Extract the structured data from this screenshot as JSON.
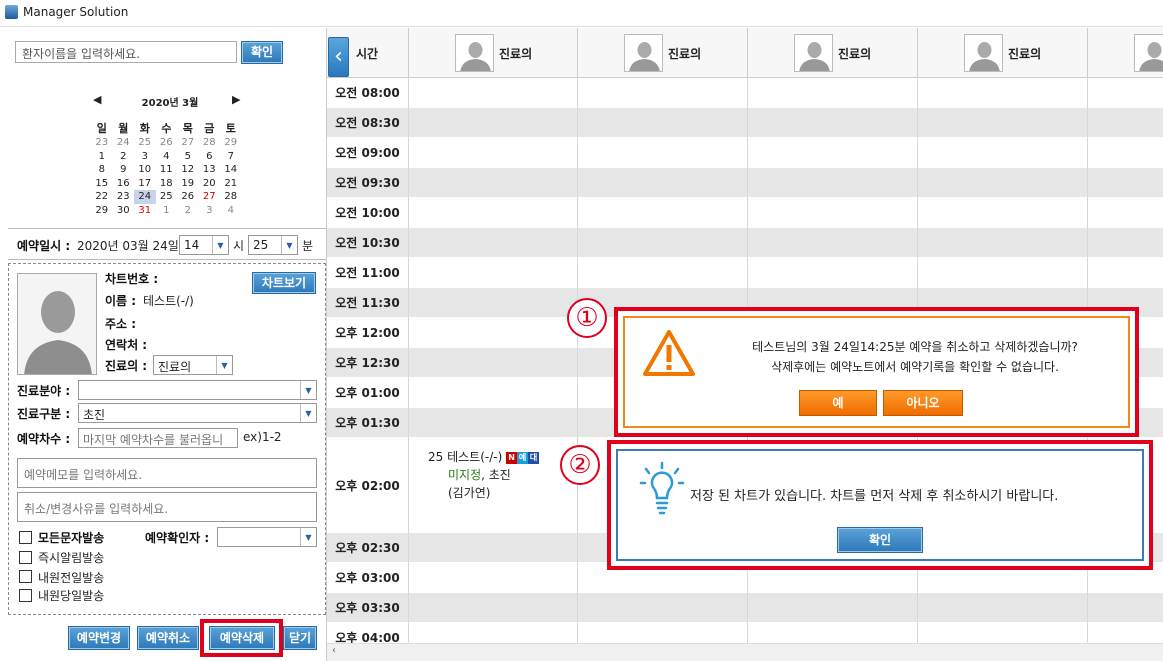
{
  "window": {
    "title": "Manager Solution"
  },
  "search": {
    "placeholder": "환자이름을 입력하세요.",
    "confirm_label": "확인"
  },
  "calendar": {
    "month": "2020년 3월",
    "weekdays": [
      "일",
      "월",
      "화",
      "수",
      "목",
      "금",
      "토"
    ],
    "weeks": [
      [
        "23",
        "24",
        "25",
        "26",
        "27",
        "28",
        "29"
      ],
      [
        "1",
        "2",
        "3",
        "4",
        "5",
        "6",
        "7"
      ],
      [
        "8",
        "9",
        "10",
        "11",
        "12",
        "13",
        "14"
      ],
      [
        "15",
        "16",
        "17",
        "18",
        "19",
        "20",
        "21"
      ],
      [
        "22",
        "23",
        "24",
        "25",
        "26",
        "27",
        "28"
      ],
      [
        "29",
        "30",
        "31",
        "1",
        "2",
        "3",
        "4"
      ]
    ],
    "selected": "24"
  },
  "appointment_time": {
    "label": "예약일시 :",
    "date": "2020년 03월 24일",
    "hour": "14",
    "hour_unit": "시",
    "minute": "25",
    "minute_unit": "분"
  },
  "patient": {
    "chart_no_label": "차트번호 :",
    "chart_no": "",
    "chart_view_label": "차트보기",
    "name_label": "이름 :",
    "name": "테스트(-/)",
    "address_label": "주소 :",
    "contact_label": "연락처 :",
    "doctor_label": "진료의 :",
    "doctor": "진료의"
  },
  "form": {
    "department_label": "진료분야 :",
    "department": "",
    "visit_type_label": "진료구분 :",
    "visit_type": "초진",
    "session_label": "예약차수 :",
    "session_placeholder": "마지막 예약차수를 불러옵니",
    "session_hint": "ex)1-2",
    "memo_placeholder": "예약메모를 입력하세요.",
    "reason_placeholder": "취소/변경사유를 입력하세요."
  },
  "options": {
    "all_sms": "모든문자발송",
    "confirmer_label": "예약확인자 :",
    "confirmer": "",
    "instant": "즉시알림발송",
    "day_before": "내원전일발송",
    "same_day": "내원당일발송"
  },
  "actions": {
    "change": "예약변경",
    "cancel": "예약취소",
    "delete": "예약삭제",
    "close": "닫기"
  },
  "schedule": {
    "time_header": "시간",
    "doctor_columns": [
      "진료의",
      "진료의",
      "진료의",
      "진료의",
      ""
    ],
    "times": [
      "오전 08:00",
      "오전 08:30",
      "오전 09:00",
      "오전 09:30",
      "오전 10:00",
      "오전 10:30",
      "오전 11:00",
      "오전 11:30",
      "오후 12:00",
      "오후 12:30",
      "오후 01:00",
      "오후 01:30",
      "오후 02:00",
      "오후 02:30",
      "오후 03:00",
      "오후 03:30",
      "오후 04:00"
    ]
  },
  "appointment": {
    "line1": "25 테스트(-/-)",
    "badges": [
      "N",
      "예",
      "대"
    ],
    "staff": "미지정",
    "visit": "초진",
    "patient2": "(김가연)"
  },
  "dialog_confirm": {
    "marker": "①",
    "message1": "테스트님의 3월 24일14:25분 예약을 취소하고 삭제하겠습니까?",
    "message2": "삭제후에는 예약노트에서 예약기록을 확인할 수 없습니다.",
    "yes": "예",
    "no": "아니오"
  },
  "dialog_info": {
    "marker": "②",
    "message": "저장 된 차트가 있습니다. 차트를 먼저 삭제 후 취소하시기 바랍니다.",
    "ok": "확인"
  },
  "colors": {
    "accent_blue": "#2d78b8",
    "warning_orange": "#f07800",
    "highlight_red": "#e0001b",
    "selected_day": "#c8d2ea",
    "row_alt": "#e6e6e6"
  }
}
